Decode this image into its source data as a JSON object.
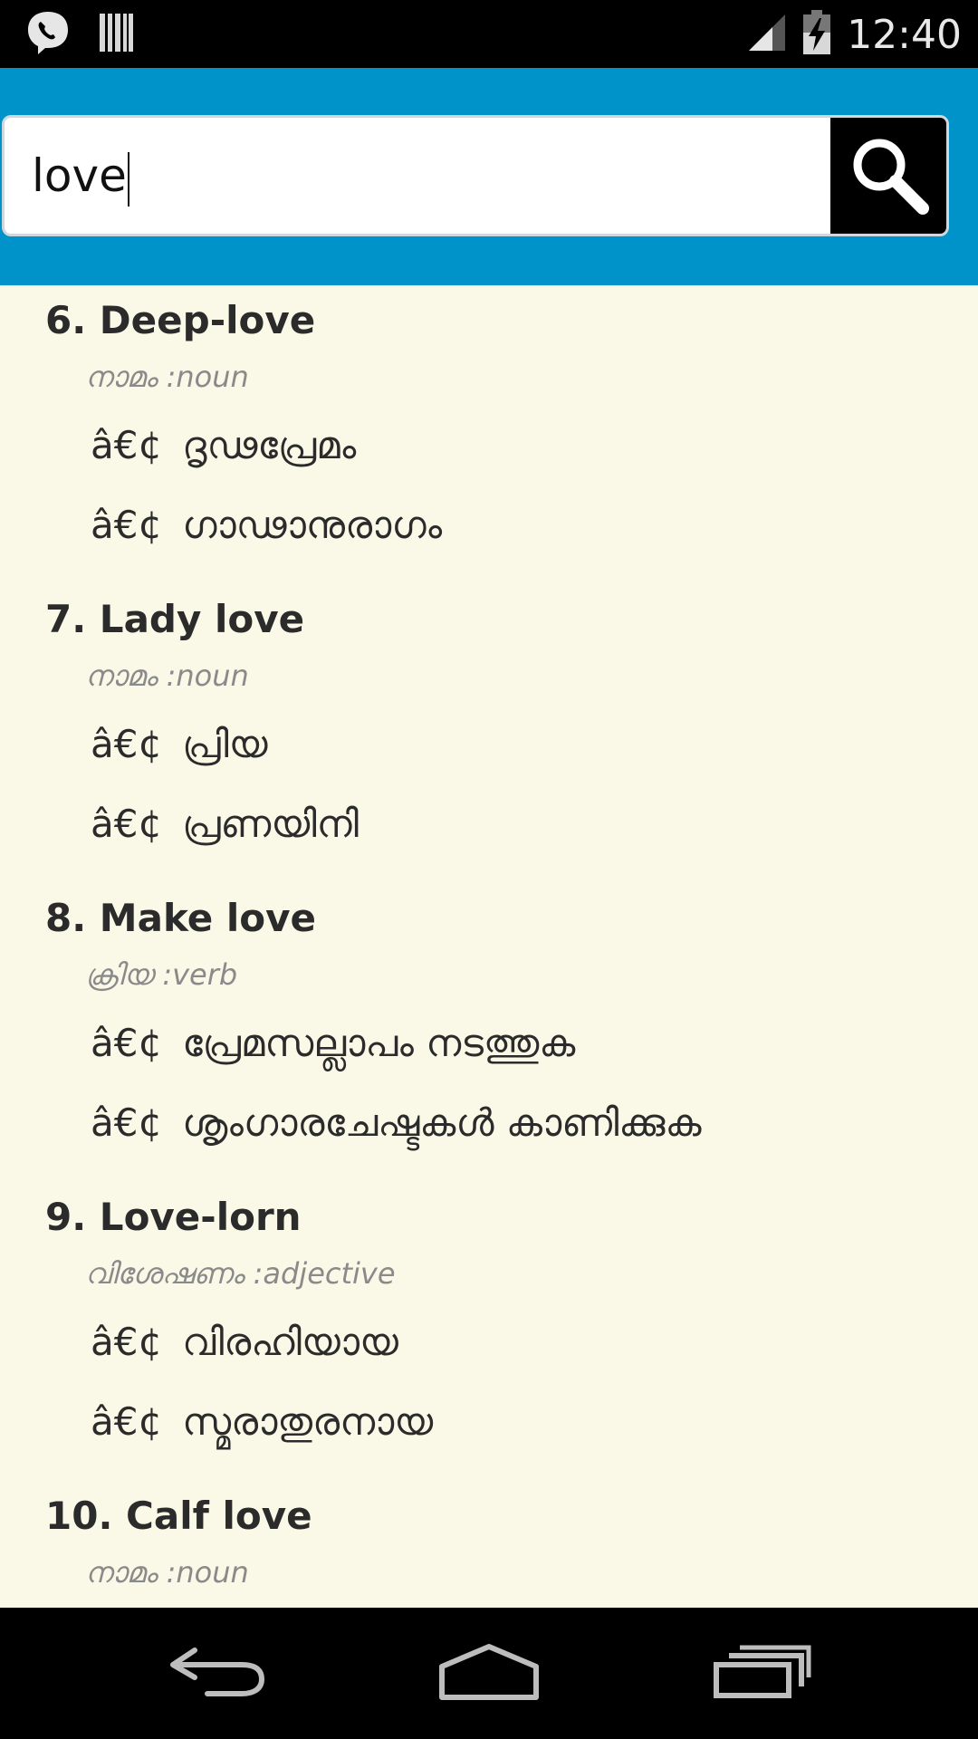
{
  "status_bar": {
    "time": "12:40",
    "icons": [
      "viber-icon",
      "barcode-icon",
      "signal-icon",
      "battery-charging-icon"
    ]
  },
  "search": {
    "value": "love",
    "button_icon": "search-icon"
  },
  "results": [
    {
      "title": "6. Deep-love",
      "pos": "നാമം :noun",
      "defs": [
        "ദൃഢപ്രേമം",
        "ഗാഢാനുരാഗം"
      ]
    },
    {
      "title": "7. Lady love",
      "pos": "നാമം :noun",
      "defs": [
        "പ്രിയ",
        "പ്രണയിനി"
      ]
    },
    {
      "title": "8. Make love",
      "pos": "ക്രിയ :verb",
      "defs": [
        "പ്രേമസല്ലാപം നടത്തുക",
        "ശൃംഗാരചേഷ്ടകൾ കാണിക്കുക"
      ]
    },
    {
      "title": "9. Love-lorn",
      "pos": "വിശേഷണം :adjective",
      "defs": [
        "വിരഹിയായ",
        "സ്മരാതുരനായ"
      ]
    },
    {
      "title": "10. Calf love",
      "pos": "നാമം :noun",
      "defs": []
    }
  ],
  "bullet": "â€¢",
  "navbar": {
    "icons": [
      "back-icon",
      "home-icon",
      "recent-apps-icon"
    ]
  }
}
